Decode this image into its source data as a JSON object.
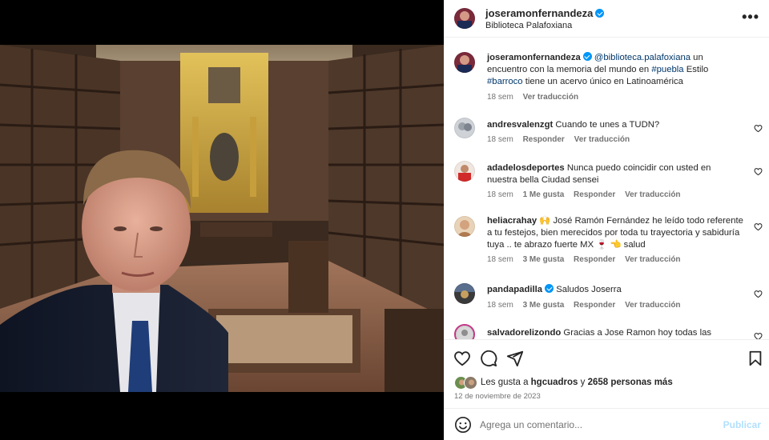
{
  "post": {
    "username": "joseramonfernandeza",
    "location": "Biblioteca Palafoxiana",
    "image_alt": "Hombre frente a la Biblioteca Palafoxiana"
  },
  "caption": {
    "username": "joseramonfernandeza",
    "mention": "@biblioteca.palafoxiana",
    "text_1": " un encuentro con la memoria del mundo en ",
    "hashtag_1": "#puebla",
    "text_2": " Estilo ",
    "hashtag_2": "#barroco",
    "text_3": " tiene un acervo único en Latinoamérica",
    "time": "18 sem",
    "translate": "Ver traducción"
  },
  "comments": [
    {
      "username": "andresvalenzgt",
      "text": "Cuando te unes a TUDN?",
      "time": "18 sem",
      "likes": "",
      "reply": "Responder",
      "translate": "Ver traducción"
    },
    {
      "username": "adadelosdeportes",
      "text": "Nunca puedo coincidir con usted en nuestra bella Ciudad sensei",
      "time": "18 sem",
      "likes": "1 Me gusta",
      "reply": "Responder",
      "translate": "Ver traducción"
    },
    {
      "username": "heliacrahay",
      "text": "🙌 José Ramón Fernández he leído todo referente a tu festejos, bien merecidos por toda tu trayectoria y sabiduría tuya .. te abrazo fuerte MX 🍷 👈 salud",
      "time": "18 sem",
      "likes": "3 Me gusta",
      "reply": "Responder",
      "translate": "Ver traducción"
    },
    {
      "username": "pandapadilla",
      "text": "Saludos Joserra",
      "time": "18 sem",
      "likes": "3 Me gusta",
      "reply": "Responder",
      "translate": "Ver traducción"
    },
    {
      "username": "salvadorelizondo",
      "text": "Gracias a Jose Ramon hoy todas las",
      "time": "",
      "likes": "",
      "reply": "",
      "translate": ""
    }
  ],
  "likes": {
    "prefix": "Les gusta a ",
    "user": "hgcuadros",
    "middle": " y ",
    "count": "2658 personas más"
  },
  "date": "12 de noviembre de 2023",
  "add_comment": {
    "placeholder": "Agrega un comentario...",
    "publish_label": "Publicar"
  },
  "icons": {
    "more": "more-options-icon",
    "like": "heart-icon",
    "comment": "comment-icon",
    "share": "share-icon",
    "save": "bookmark-icon",
    "emoji": "emoji-icon",
    "verified": "verified-badge-icon"
  },
  "colors": {
    "verified": "#0095f6",
    "link": "#00376b",
    "secondary_text": "#737373",
    "publish_disabled": "#b2dffc"
  }
}
